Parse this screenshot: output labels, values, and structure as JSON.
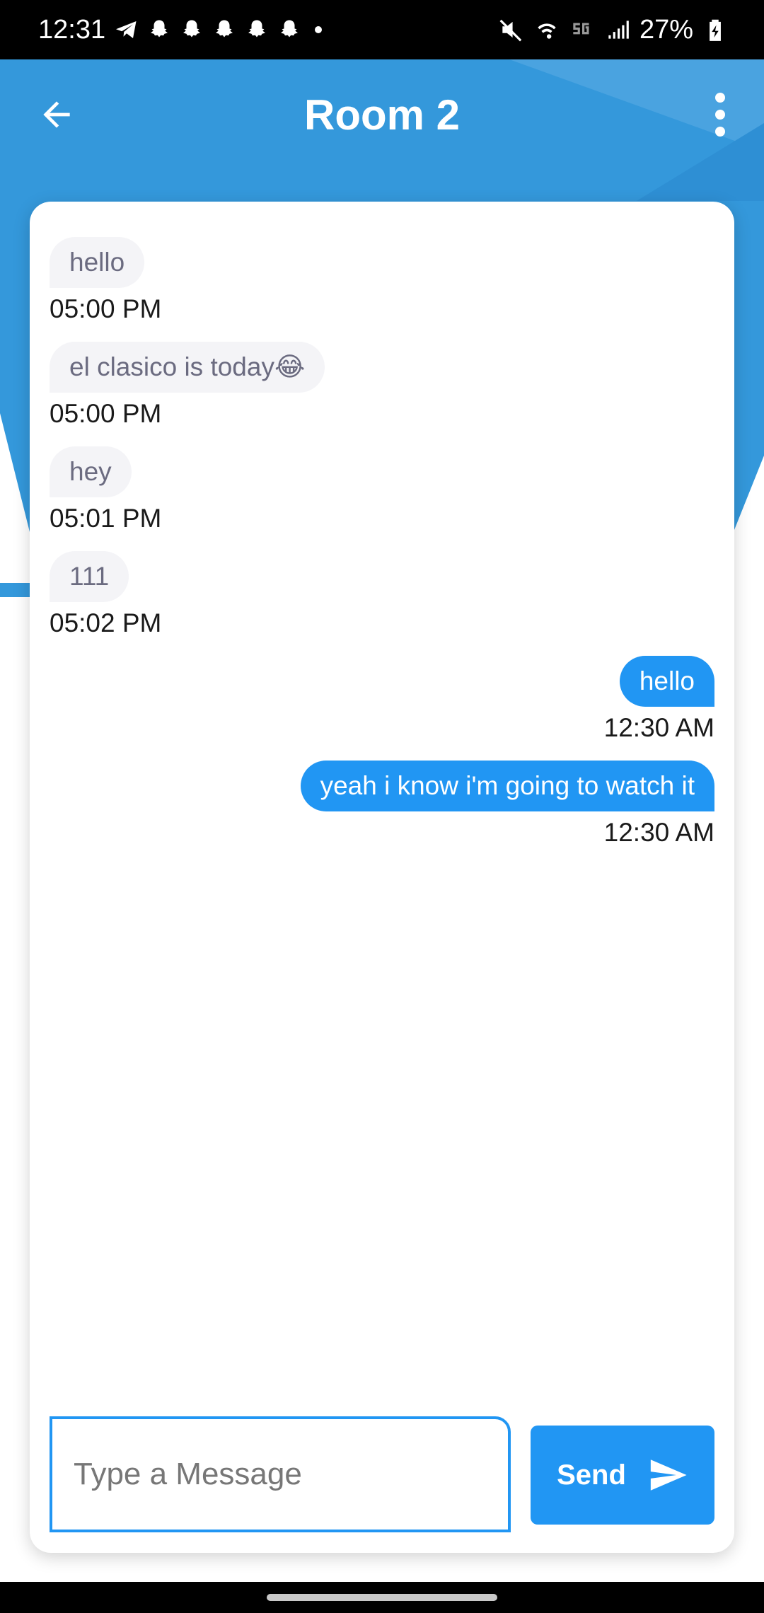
{
  "status_bar": {
    "time": "12:31",
    "battery": "27%",
    "notification_icons": [
      "telegram-icon",
      "snapchat-icon",
      "snapchat-icon",
      "snapchat-icon",
      "snapchat-icon",
      "snapchat-icon"
    ]
  },
  "app_bar": {
    "title": "Room 2"
  },
  "messages": [
    {
      "direction": "in",
      "text": "hello",
      "time": "05:00 PM"
    },
    {
      "direction": "in",
      "text": "el clasico is today😂",
      "time": "05:00 PM"
    },
    {
      "direction": "in",
      "text": "hey",
      "time": "05:01 PM"
    },
    {
      "direction": "in",
      "text": "111",
      "time": "05:02 PM"
    },
    {
      "direction": "out",
      "text": "hello",
      "time": "12:30 AM"
    },
    {
      "direction": "out",
      "text": "yeah i know i'm going to watch it",
      "time": "12:30 AM"
    }
  ],
  "composer": {
    "placeholder": "Type a Message",
    "value": "",
    "send_label": "Send"
  },
  "colors": {
    "header_blue": "#3498db",
    "accent": "#2196f3",
    "incoming_bubble": "#f4f4f7"
  }
}
